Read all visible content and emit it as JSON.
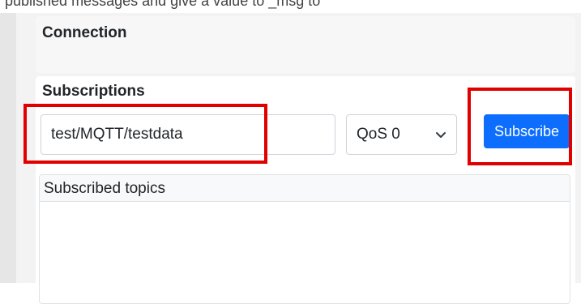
{
  "caption": "published messages and give a value  to _msg  to",
  "connection": {
    "title": "Connection"
  },
  "subscriptions": {
    "title": "Subscriptions",
    "topic_value": "test/MQTT/testdata",
    "qos_selected": "QoS 0",
    "subscribe_label": "Subscribe",
    "subscribed_topics_header": "Subscribed topics"
  },
  "colors": {
    "accent": "#0d6efd",
    "highlight": "#e00000"
  },
  "icons": {
    "qos_dropdown": "chevron-down-icon"
  }
}
